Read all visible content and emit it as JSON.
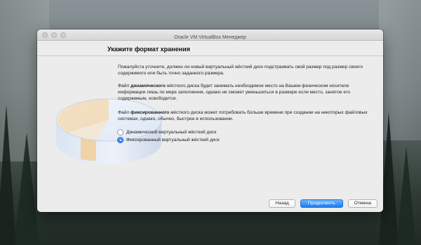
{
  "window": {
    "title": "Oracle VM VirtualBox Менеджер"
  },
  "page": {
    "heading": "Укажите формат хранения",
    "intro": "Пожалуйста уточните, должен ли новый виртуальный жёсткий диск подстраивать свой размер под размер своего содержимого или быть точно заданного размера.",
    "dynamic_desc": {
      "prefix": "Файл ",
      "emphasis": "динамического",
      "suffix": " жёсткого диска будет занимать необходимое место на Вашем физическом носителе информации лишь по мере заполнения, однако не сможет уменьшиться в размере если место, занятое его содержимым, освободится."
    },
    "fixed_desc": {
      "prefix": "Файл ",
      "emphasis": "фиксированного",
      "suffix": " жёсткого диска может потребовать больше времени при создании на некоторых файловых системах, однако, обычно, быстрее в использовании."
    }
  },
  "options": [
    {
      "label": "Динамический виртуальный жёсткий диск",
      "selected": false
    },
    {
      "label": "Фиксированный виртуальный жёсткий диск",
      "selected": true
    }
  ],
  "buttons": {
    "back": "Назад",
    "continue": "Продолжить",
    "cancel": "Отмена"
  },
  "colors": {
    "accent": "#2a74ec",
    "window_bg": "#ececec"
  },
  "icons": {
    "disk_art": "hard-disk-illustration"
  }
}
